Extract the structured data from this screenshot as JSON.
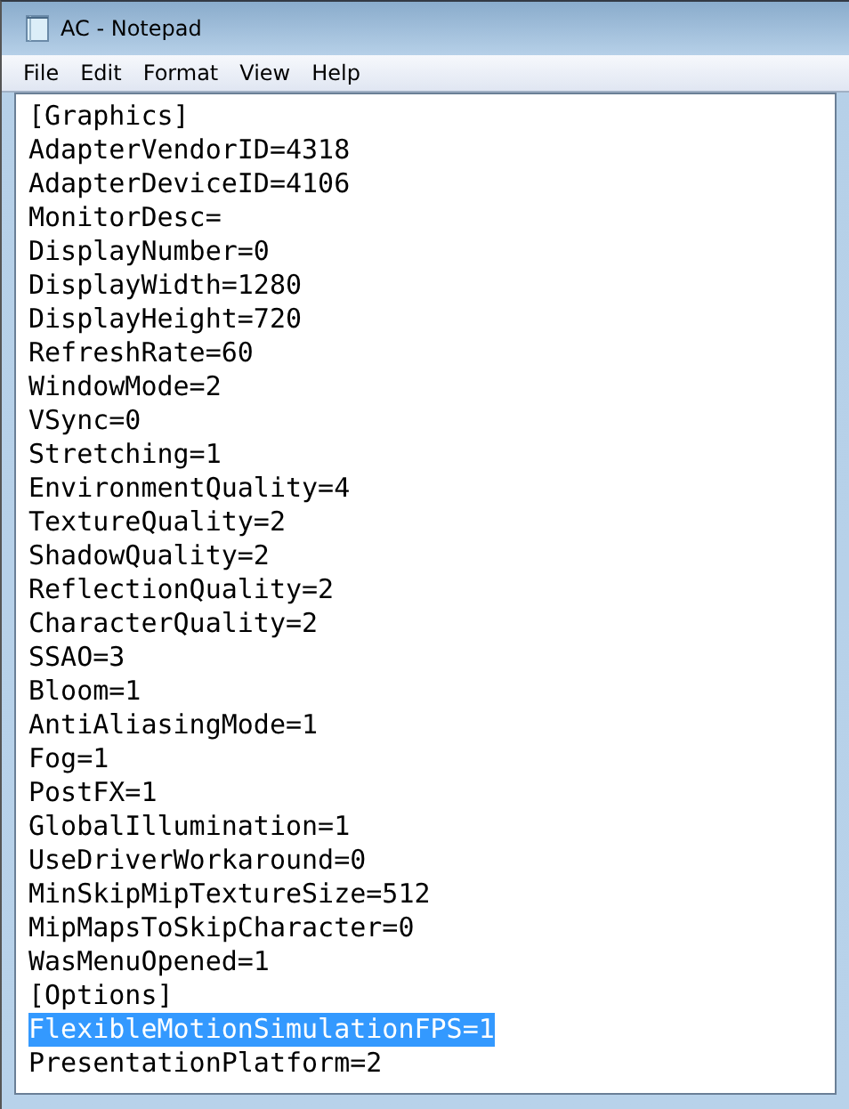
{
  "window": {
    "title": "AC - Notepad"
  },
  "menu": [
    "File",
    "Edit",
    "Format",
    "View",
    "Help"
  ],
  "lines": [
    {
      "text": "[Graphics]",
      "selected": false
    },
    {
      "text": "AdapterVendorID=4318",
      "selected": false
    },
    {
      "text": "AdapterDeviceID=4106",
      "selected": false
    },
    {
      "text": "MonitorDesc=",
      "selected": false
    },
    {
      "text": "DisplayNumber=0",
      "selected": false
    },
    {
      "text": "DisplayWidth=1280",
      "selected": false
    },
    {
      "text": "DisplayHeight=720",
      "selected": false
    },
    {
      "text": "RefreshRate=60",
      "selected": false
    },
    {
      "text": "WindowMode=2",
      "selected": false
    },
    {
      "text": "VSync=0",
      "selected": false
    },
    {
      "text": "Stretching=1",
      "selected": false
    },
    {
      "text": "EnvironmentQuality=4",
      "selected": false
    },
    {
      "text": "TextureQuality=2",
      "selected": false
    },
    {
      "text": "ShadowQuality=2",
      "selected": false
    },
    {
      "text": "ReflectionQuality=2",
      "selected": false
    },
    {
      "text": "CharacterQuality=2",
      "selected": false
    },
    {
      "text": "SSAO=3",
      "selected": false
    },
    {
      "text": "Bloom=1",
      "selected": false
    },
    {
      "text": "AntiAliasingMode=1",
      "selected": false
    },
    {
      "text": "Fog=1",
      "selected": false
    },
    {
      "text": "PostFX=1",
      "selected": false
    },
    {
      "text": "GlobalIllumination=1",
      "selected": false
    },
    {
      "text": "UseDriverWorkaround=0",
      "selected": false
    },
    {
      "text": "MinSkipMipTextureSize=512",
      "selected": false
    },
    {
      "text": "MipMapsToSkipCharacter=0",
      "selected": false
    },
    {
      "text": "WasMenuOpened=1",
      "selected": false
    },
    {
      "text": "[Options]",
      "selected": false
    },
    {
      "text": "FlexibleMotionSimulationFPS=1",
      "selected": true
    },
    {
      "text": "PresentationPlatform=2",
      "selected": false
    }
  ]
}
